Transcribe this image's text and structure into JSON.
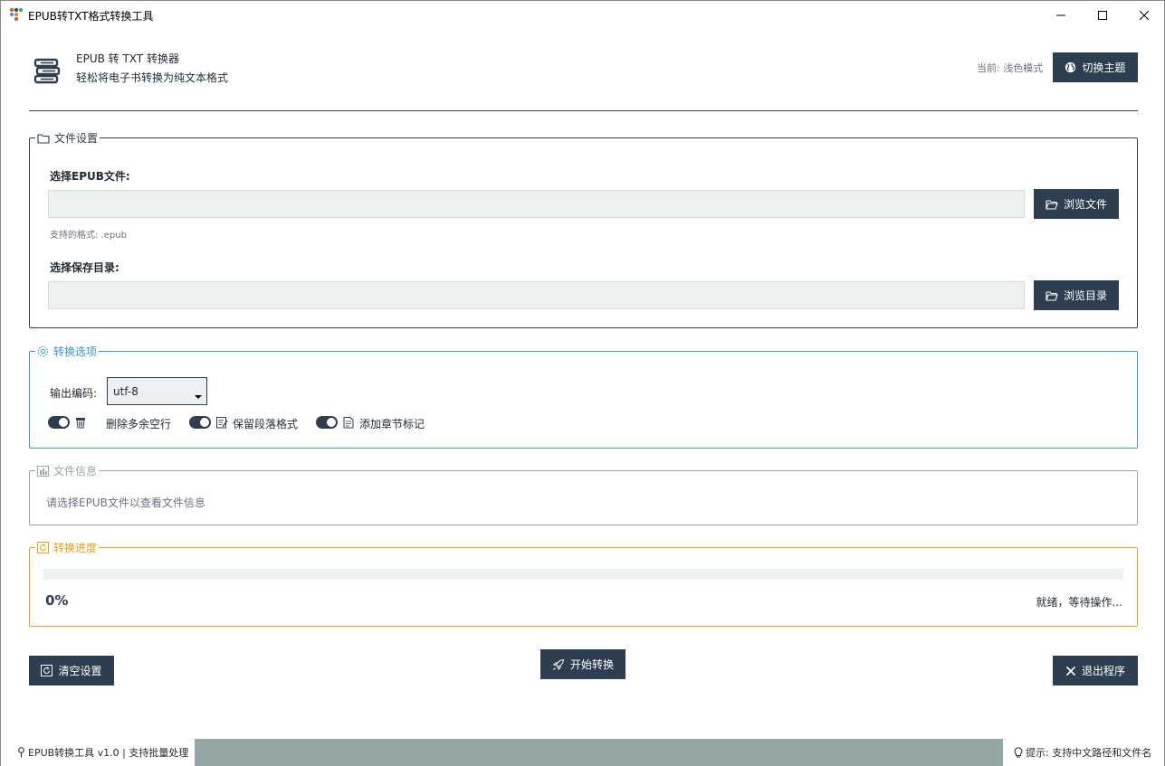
{
  "window": {
    "title": "EPUB转TXT格式转换工具"
  },
  "header": {
    "title": "EPUB 转 TXT 转换器",
    "subtitle": "轻松将电子书转换为纯文本格式",
    "mode_text": "当前: 浅色模式",
    "theme_button": "切换主题"
  },
  "file_settings": {
    "legend": "文件设置",
    "epub_label": "选择EPUB文件:",
    "epub_value": "",
    "browse_file": "浏览文件",
    "supported_hint": "支持的格式: .epub",
    "dir_label": "选择保存目录:",
    "dir_value": "",
    "browse_dir": "浏览目录"
  },
  "options": {
    "legend": "转换选项",
    "encoding_label": "输出编码:",
    "encoding_value": "utf-8",
    "toggles": [
      {
        "label": "删除多余空行",
        "on": true,
        "icon": "trash-icon"
      },
      {
        "label": "保留段落格式",
        "on": true,
        "icon": "memo-icon"
      },
      {
        "label": "添加章节标记",
        "on": true,
        "icon": "document-icon"
      }
    ]
  },
  "file_info": {
    "legend": "文件信息",
    "placeholder": "请选择EPUB文件以查看文件信息"
  },
  "progress": {
    "legend": "转换进度",
    "percent_text": "0%",
    "fraction": 0,
    "status": "就绪，等待操作..."
  },
  "actions": {
    "clear": "清空设置",
    "start": "开始转换",
    "exit": "退出程序"
  },
  "statusbar": {
    "left": "EPUB转换工具 v1.0 | 支持批量处理",
    "right": "提示: 支持中文路径和文件名"
  },
  "colors": {
    "primary": "#2c3e50",
    "options_border": "#3498db",
    "info_border": "#95a5a6",
    "progress_border": "#f39c12",
    "input_bg": "#ecf0f1"
  }
}
